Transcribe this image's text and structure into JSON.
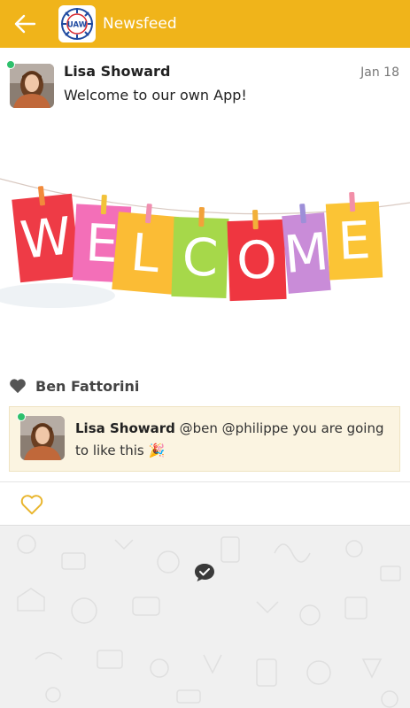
{
  "header": {
    "title": "Newsfeed",
    "logo_text": "UAW",
    "accent": "#f0b41a"
  },
  "post": {
    "author": "Lisa Showard",
    "date": "Jan 18",
    "text": "Welcome to our own App!",
    "banner_letters": [
      "W",
      "E",
      "L",
      "C",
      "O",
      "M",
      "E"
    ],
    "banner_colors": [
      "#ee3b46",
      "#f36fb8",
      "#fbbc35",
      "#a6d84a",
      "#ef3640",
      "#c98cd8",
      "#fbc435"
    ]
  },
  "likes": {
    "name": "Ben Fattorini"
  },
  "comment": {
    "author": "Lisa Showard",
    "text": "@ben @philippe you are going to like this 🎉"
  },
  "icons": {
    "back": "arrow-left-icon",
    "heart": "heart-icon",
    "like": "heart-outline-icon",
    "chat": "chat-check-icon"
  }
}
